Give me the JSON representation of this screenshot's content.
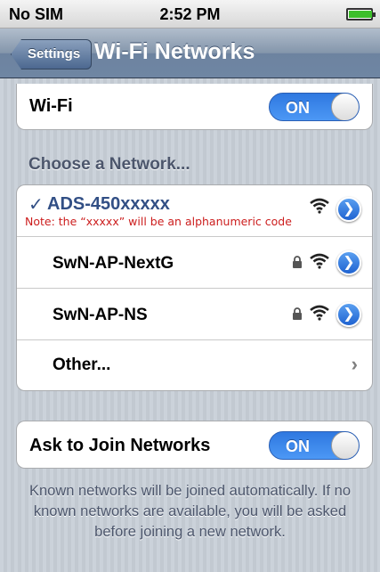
{
  "status_bar": {
    "carrier": "No SIM",
    "time": "2:52 PM",
    "battery_icon": "battery-full-icon"
  },
  "nav": {
    "back_label": "Settings",
    "title": "Wi-Fi Networks"
  },
  "wifi_toggle": {
    "label": "Wi-Fi",
    "state": "ON"
  },
  "section_header": "Choose a Network...",
  "networks": [
    {
      "name": "ADS-450xxxxx",
      "selected": true,
      "note": "Note: the “xxxxx” will be an alphanumeric code",
      "locked": false
    },
    {
      "name": "SwN-AP-NextG",
      "selected": false,
      "locked": true
    },
    {
      "name": "SwN-AP-NS",
      "selected": false,
      "locked": true
    }
  ],
  "other": {
    "label": "Other..."
  },
  "ask_join": {
    "label": "Ask to Join Networks",
    "state": "ON"
  },
  "footer": "Known networks will be joined automatically. If no known networks are available, you will be asked before joining a new network.",
  "icons": {
    "checkmark": "✓",
    "info": "❯",
    "chevron": "›"
  },
  "colors": {
    "accent_blue": "#2f78e0",
    "selected_text": "#324f85",
    "note_red": "#cc1d1d",
    "nav_bar": "#6f86a3"
  }
}
